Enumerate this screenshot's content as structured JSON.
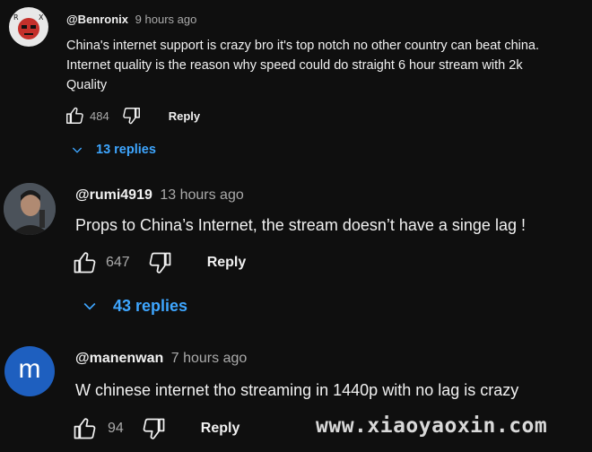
{
  "comments": [
    {
      "handle": "@Benronix",
      "time": "9 hours ago",
      "lines": [
        "China's internet support is crazy bro it's top notch no other country can beat china.",
        "Internet quality is the reason why speed could do straight 6 hour stream with 2k",
        "Quality"
      ],
      "likes": "484",
      "reply_label": "Reply",
      "replies_label": "13 replies"
    },
    {
      "handle": "@rumi4919",
      "time": "13 hours ago",
      "lines": [
        "Props to China’s Internet, the stream doesn’t have a singe lag !"
      ],
      "likes": "647",
      "reply_label": "Reply",
      "replies_label": "43 replies"
    },
    {
      "handle": "@manenwan",
      "time": "7 hours ago",
      "avatar_letter": "m",
      "lines": [
        "W chinese internet tho streaming in 1440p with no lag is crazy"
      ],
      "likes": "94",
      "reply_label": "Reply"
    }
  ],
  "watermark": "www.xiaoyaoxin.com",
  "colors": {
    "background": "#0f0f0f",
    "text": "#f1f1f1",
    "muted": "#aaaaaa",
    "link": "#3ea6ff",
    "avatar_m": "#1e5fbf"
  }
}
